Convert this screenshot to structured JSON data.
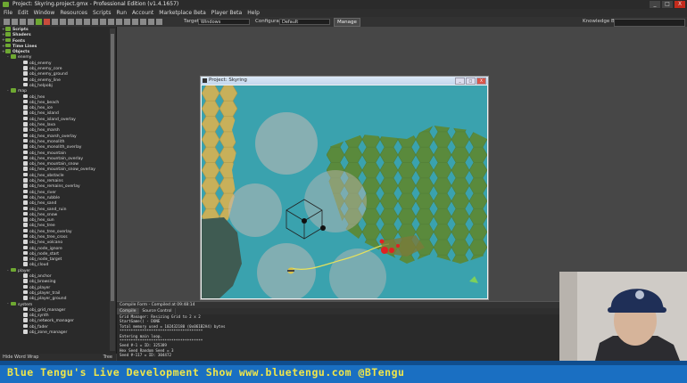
{
  "window": {
    "title": "Project: Skyring.project.gmx - Professional Edition (v1.4.1657)",
    "controls": [
      "_",
      "□",
      "X"
    ]
  },
  "menu": [
    "File",
    "Edit",
    "Window",
    "Resources",
    "Scripts",
    "Run",
    "Account",
    "Marketplace Beta",
    "Player Beta",
    "Help"
  ],
  "toolbar": {
    "target_label": "Target:",
    "target_value": "Windows",
    "config_label": "Configuration:",
    "config_value": "Default",
    "manage_label": "Manage",
    "knowledge_label": "Knowledge Base:"
  },
  "tree": {
    "top_folders": [
      "Scripts",
      "Shaders",
      "Fonts",
      "Time Lines",
      "Objects"
    ],
    "groups": [
      {
        "name": "enemy",
        "items": [
          "obj_enemy",
          "obj_enemy_core",
          "obj_enemy_ground",
          "obj_enemy_line",
          "obj_helpobj"
        ]
      },
      {
        "name": "map",
        "items": [
          "obj_hex",
          "obj_hex_beach",
          "obj_hex_ice",
          "obj_hex_island",
          "obj_hex_island_overlay",
          "obj_hex_lava",
          "obj_hex_marsh",
          "obj_hex_marsh_overlay",
          "obj_hex_monolith",
          "obj_hex_monolith_overlay",
          "obj_hex_mountain",
          "obj_hex_mountain_overlay",
          "obj_hex_mountain_snow",
          "obj_hex_mountain_snow_overlay",
          "obj_hex_obstacle",
          "obj_hex_remains",
          "obj_hex_remains_overlay",
          "obj_hex_river",
          "obj_hex_rubble",
          "obj_hex_sand",
          "obj_hex_sand_ruin",
          "obj_hex_snow",
          "obj_hex_sun",
          "obj_hex_tree",
          "obj_hex_tree_overlay",
          "obj_hex_tree_cross",
          "obj_hex_volcano",
          "obj_node_ignore",
          "obj_node_start",
          "obj_node_target",
          "obj_cloud"
        ]
      },
      {
        "name": "player",
        "items": [
          "obj_anchor",
          "obj_browsing",
          "obj_player",
          "obj_player_trail",
          "obj_player_ground"
        ]
      },
      {
        "name": "system",
        "items": [
          "obj_grid_manager",
          "obj_synth",
          "obj_network_manager",
          "obj_fader",
          "obj_zone_manager"
        ]
      }
    ],
    "footer": "Hide Word Wrap",
    "footer_right": "Tree"
  },
  "game_window": {
    "title": "Project: Skyring",
    "buttons": [
      "_",
      "□",
      "X"
    ]
  },
  "output": {
    "title": "Compile Form - Compiled at 09:48:14",
    "tabs": [
      "Compile",
      "Source Control"
    ],
    "lines": [
      "Grid Manager: Resizing Grid to 2 x 2",
      "StartGame() - DONE",
      "Total memory used = 102432180 (0x061B2A4) bytes",
      "*************************************",
      "Entering main loop.",
      "*************************************",
      "Seed #-1 = ID: 325389",
      "Hex Seed Random Seed = 3",
      "Seed #-117 = ID: 304472"
    ]
  },
  "banner": {
    "text": "Blue Tengu's Live Development Show   www.bluetengu.com   @BTengu"
  },
  "colors": {
    "ide_bg": "#474747",
    "water": "#3aa2ae",
    "land": "#5a8a3c",
    "sand": "#c8b05a",
    "banner": "#1a6fc2",
    "banner_text": "#f0e64a",
    "accent_green": "#6ea832"
  }
}
